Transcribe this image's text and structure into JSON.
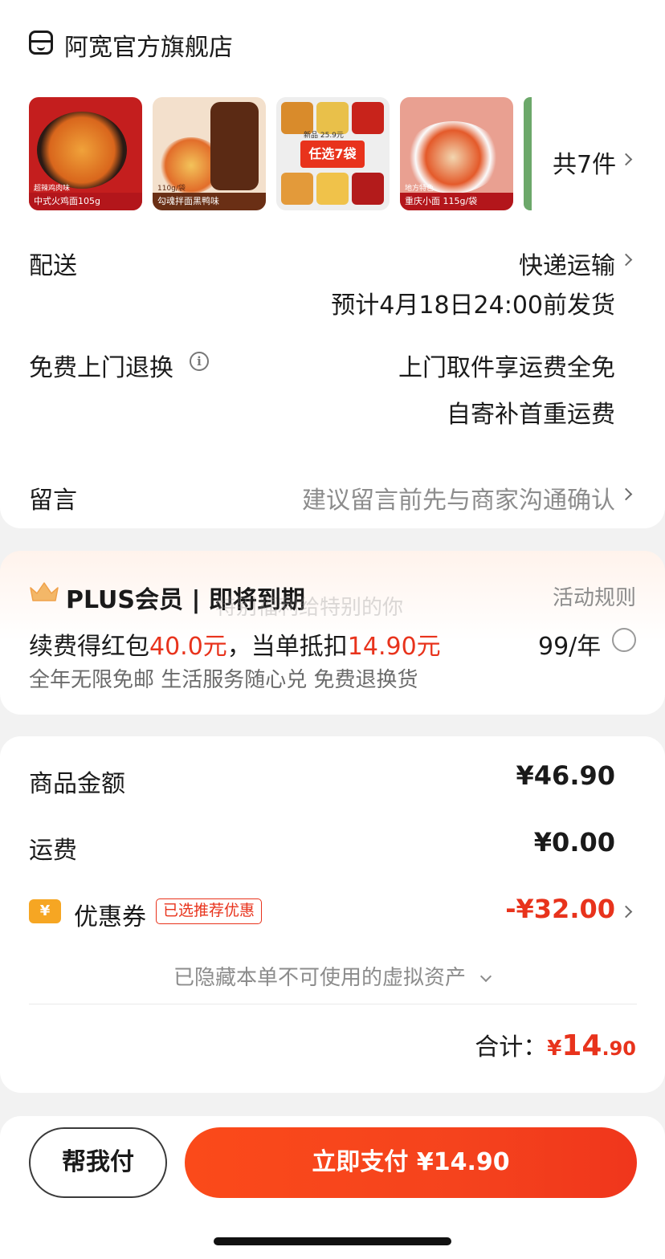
{
  "shop": {
    "name": "阿宽官方旗舰店",
    "icon": "shop-icon"
  },
  "products": {
    "thumbnails": [
      {
        "caption_top": "超辣鸡肉味",
        "caption": "中式火鸡面105g",
        "colors": [
          "#c41e1e",
          "#e06a1a"
        ]
      },
      {
        "caption_top": "110g/袋",
        "caption": "勾魂拌面黑鸭味",
        "colors": [
          "#f3e0cc",
          "#5b2a14"
        ]
      },
      {
        "caption_top": "新品 25.9元",
        "caption": "任选7袋",
        "colors": [
          "#d6d6d6",
          "#e8331c"
        ]
      },
      {
        "caption_top": "地方特色",
        "caption": "重庆小面 115g/袋",
        "colors": [
          "#e9a091",
          "#c8231b"
        ]
      }
    ],
    "count_label": "共7件"
  },
  "delivery": {
    "label": "配送",
    "method": "快递运输",
    "estimate": "预计4月18日24:00前发货"
  },
  "return_service": {
    "label": "免费上门退换",
    "line1": "上门取件享运费全免",
    "line2": "自寄补首重运费"
  },
  "message": {
    "label": "留言",
    "placeholder": "建议留言前先与商家沟通确认"
  },
  "plus": {
    "title": "PLUS会员 | 即将到期",
    "overlay_text": "特别福利给特别的你",
    "rules_link": "活动规则",
    "renew_prefix": "续费得红包",
    "renew_amount": "40.0元",
    "renew_mid": "，当单抵扣",
    "deduct_amount": "14.90元",
    "price": "99/年",
    "benefits": "全年无限免邮 生活服务随心兑 免费退换货"
  },
  "price_summary": {
    "goods_label": "商品金额",
    "goods_value": "¥46.90",
    "shipping_label": "运费",
    "shipping_value": "¥0.00",
    "coupon_label": "优惠券",
    "coupon_badge": "已选推荐优惠",
    "coupon_value": "-¥32.00",
    "hidden_assets": "已隐藏本单不可使用的虚拟资产",
    "total_label": "合计：",
    "total_currency": "¥",
    "total_int": "14",
    "total_dec": ".90"
  },
  "actions": {
    "help_pay": "帮我付",
    "pay_now": "立即支付  ¥14.90"
  },
  "colors": {
    "accent": "#e8331c",
    "plus_gold": "#f0b060",
    "coupon_icon": "#f6a623"
  }
}
